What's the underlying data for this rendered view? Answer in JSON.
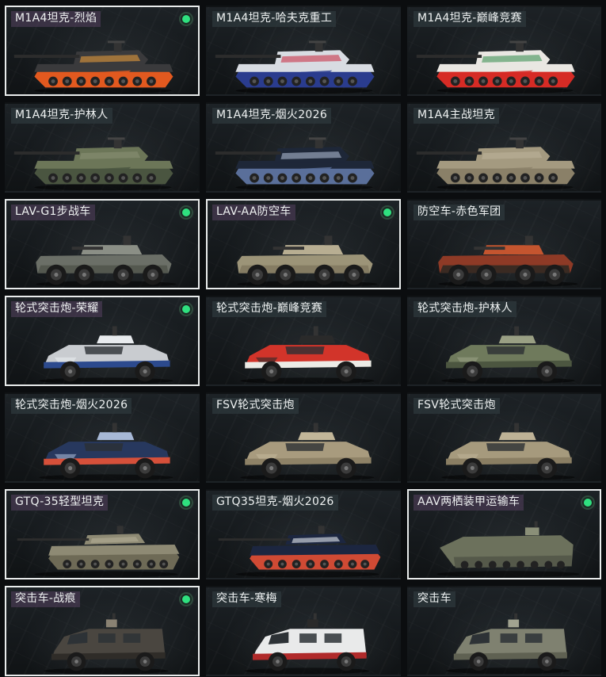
{
  "vehicles": [
    {
      "name": "M1A4坦克-烈焰",
      "owned": true,
      "kind": "tank",
      "colors": {
        "body": "#3a3a3c",
        "accent": "#e2591f",
        "detail": "#f2a23a"
      }
    },
    {
      "name": "M1A4坦克-哈夫克重工",
      "owned": false,
      "kind": "tank",
      "colors": {
        "body": "#d8dce2",
        "accent": "#2a3c8e",
        "detail": "#c8243a"
      }
    },
    {
      "name": "M1A4坦克-巅峰竞赛",
      "owned": false,
      "kind": "tank",
      "colors": {
        "body": "#e9e7e2",
        "accent": "#d62b25",
        "detail": "#2f8a48"
      }
    },
    {
      "name": "M1A4坦克-护林人",
      "owned": false,
      "kind": "tank",
      "colors": {
        "body": "#6c7658",
        "accent": "#4a5540",
        "detail": "#8c9276"
      }
    },
    {
      "name": "M1A4坦克-烟火2026",
      "owned": false,
      "kind": "tank",
      "colors": {
        "body": "#1e2738",
        "accent": "#5a6f9a",
        "detail": "#b9c6dc"
      }
    },
    {
      "name": "M1A4主战坦克",
      "owned": false,
      "kind": "tank",
      "colors": {
        "body": "#a49a80",
        "accent": "#8a8068",
        "detail": "#bdb49b"
      }
    },
    {
      "name": "LAV-G1步战车",
      "owned": true,
      "kind": "lav",
      "colors": {
        "body": "#6b6f67",
        "accent": "#54584f",
        "detail": "#8b8f86"
      }
    },
    {
      "name": "LAV-AA防空车",
      "owned": true,
      "kind": "lav",
      "colors": {
        "body": "#9c9478",
        "accent": "#857c63",
        "detail": "#b8ae92"
      }
    },
    {
      "name": "防空车-赤色军团",
      "owned": false,
      "kind": "lav",
      "colors": {
        "body": "#8e3a26",
        "accent": "#3a2a22",
        "detail": "#c4552f"
      }
    },
    {
      "name": "轮式突击炮-荣耀",
      "owned": true,
      "kind": "wheeled",
      "colors": {
        "body": "#c9ccd0",
        "accent": "#2c4a8e",
        "detail": "#e8ebee"
      }
    },
    {
      "name": "轮式突击炮-巅峰竞赛",
      "owned": false,
      "kind": "wheeled",
      "colors": {
        "body": "#d2342a",
        "accent": "#ecebe6",
        "detail": "#2a2a2a"
      }
    },
    {
      "name": "轮式突击炮-护林人",
      "owned": false,
      "kind": "wheeled",
      "colors": {
        "body": "#6f7a5c",
        "accent": "#4c5640",
        "detail": "#9aa084"
      }
    },
    {
      "name": "轮式突击炮-烟火2026",
      "owned": false,
      "kind": "wheeled",
      "colors": {
        "body": "#27385e",
        "accent": "#d6503a",
        "detail": "#a7b8d6"
      }
    },
    {
      "name": "FSV轮式突击炮",
      "owned": false,
      "kind": "wheeled",
      "colors": {
        "body": "#a89b7e",
        "accent": "#8e8267",
        "detail": "#c2b699"
      }
    },
    {
      "name": "FSV轮式突击炮",
      "owned": false,
      "kind": "wheeled",
      "colors": {
        "body": "#a69a7d",
        "accent": "#8a7e63",
        "detail": "#beb296"
      }
    },
    {
      "name": "GTQ-35轻型坦克",
      "owned": true,
      "kind": "light",
      "colors": {
        "body": "#8e8a74",
        "accent": "#6e6a56",
        "detail": "#b3ae96"
      }
    },
    {
      "name": "GTQ35坦克-烟火2026",
      "owned": false,
      "kind": "light",
      "colors": {
        "body": "#1c2640",
        "accent": "#d04a34",
        "detail": "#e6ebf2"
      }
    },
    {
      "name": "AAV两栖装甲运输车",
      "owned": true,
      "kind": "aav",
      "colors": {
        "body": "#6c715c",
        "accent": "#55594a",
        "detail": "#8a8f78"
      }
    },
    {
      "name": "突击车-战痕",
      "owned": true,
      "kind": "truck",
      "colors": {
        "body": "#4a4640",
        "accent": "#2f2c28",
        "detail": "#8a8273"
      }
    },
    {
      "name": "突击车-寒梅",
      "owned": false,
      "kind": "truck",
      "colors": {
        "body": "#e9eaea",
        "accent": "#b02a2a",
        "detail": "#2a2a2a"
      }
    },
    {
      "name": "突击车",
      "owned": false,
      "kind": "truck",
      "colors": {
        "body": "#7f8170",
        "accent": "#5f6152",
        "detail": "#a1a390"
      }
    }
  ],
  "owned_indicator_color": "#2fe07f"
}
